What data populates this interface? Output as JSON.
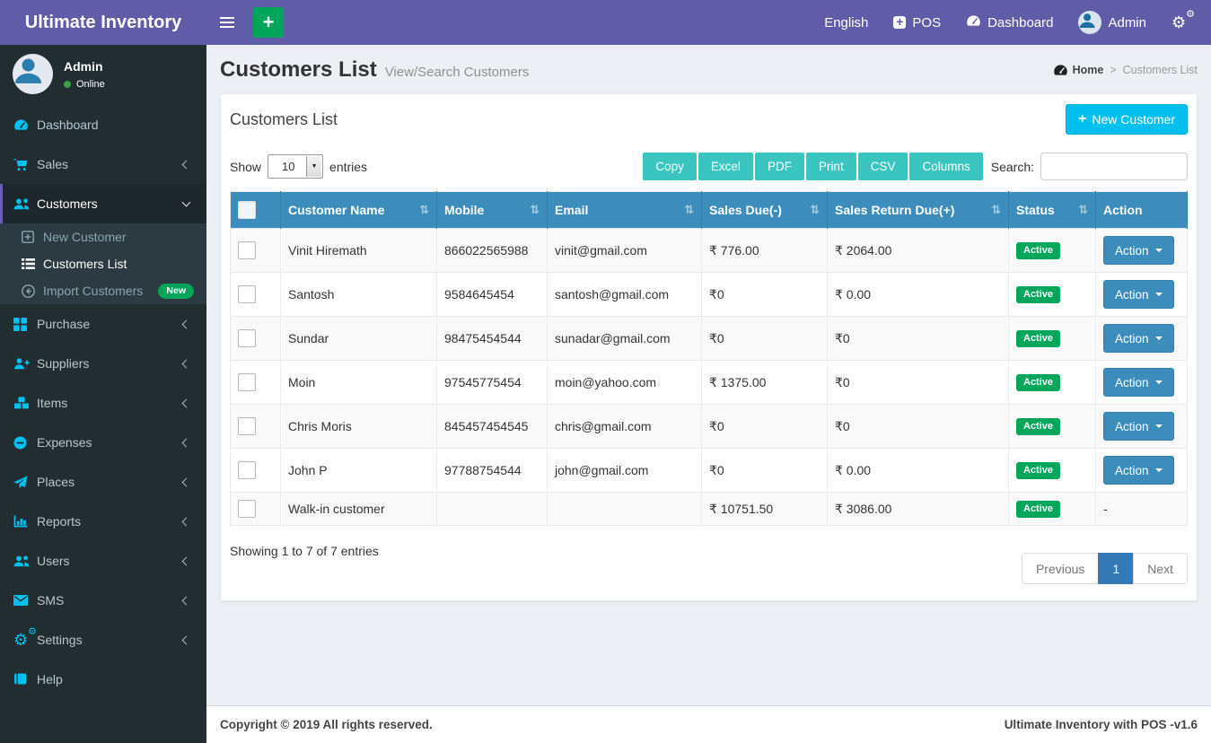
{
  "app": {
    "title": "Ultimate Inventory"
  },
  "topbar": {
    "language": "English",
    "pos_label": "POS",
    "dashboard_label": "Dashboard",
    "user": "Admin",
    "icons": [
      "menu-icon",
      "plus-button",
      "plus-square-icon",
      "gauge-icon",
      "avatar",
      "cogs-icon"
    ]
  },
  "sidebar": {
    "user": {
      "name": "Admin",
      "status": "Online"
    },
    "items": [
      {
        "label": "Dashboard",
        "icon": "gauge-icon",
        "chevron": null,
        "active": false
      },
      {
        "label": "Sales",
        "icon": "cart-icon",
        "chevron": "left",
        "active": false
      },
      {
        "label": "Customers",
        "icon": "users-icon",
        "chevron": "down",
        "active": true,
        "submenu": [
          {
            "label": "New Customer",
            "icon": "plus-square-icon",
            "active": false,
            "badge": null
          },
          {
            "label": "Customers List",
            "icon": "list-icon",
            "active": true,
            "badge": null
          },
          {
            "label": "Import Customers",
            "icon": "arrow-circle-left-icon",
            "active": false,
            "badge": "New"
          }
        ]
      },
      {
        "label": "Purchase",
        "icon": "grid-icon",
        "chevron": "left",
        "active": false
      },
      {
        "label": "Suppliers",
        "icon": "user-plus-icon",
        "chevron": "left",
        "active": false
      },
      {
        "label": "Items",
        "icon": "cubes-icon",
        "chevron": "left",
        "active": false
      },
      {
        "label": "Expenses",
        "icon": "minus-circle-icon",
        "chevron": "left",
        "active": false
      },
      {
        "label": "Places",
        "icon": "paper-plane-icon",
        "chevron": "left",
        "active": false
      },
      {
        "label": "Reports",
        "icon": "bar-chart-icon",
        "chevron": "left",
        "active": false
      },
      {
        "label": "Users",
        "icon": "users-icon",
        "chevron": "left",
        "active": false
      },
      {
        "label": "SMS",
        "icon": "envelope-icon",
        "chevron": "left",
        "active": false
      },
      {
        "label": "Settings",
        "icon": "cogs-icon",
        "chevron": "left",
        "active": false
      },
      {
        "label": "Help",
        "icon": "book-icon",
        "chevron": null,
        "active": false
      }
    ]
  },
  "page": {
    "title": "Customers List",
    "subtitle": "View/Search Customers",
    "breadcrumb": {
      "home": "Home",
      "separator": ">",
      "current": "Customers List"
    }
  },
  "card": {
    "title": "Customers List",
    "new_button_label": "New Customer"
  },
  "toolbar": {
    "show_label": "Show",
    "page_size": "10",
    "entries_label": "entries",
    "export_buttons": [
      "Copy",
      "Excel",
      "PDF",
      "Print",
      "CSV",
      "Columns"
    ],
    "search_label": "Search:",
    "search_value": ""
  },
  "table": {
    "columns": [
      {
        "label": "Customer Name",
        "sortable": true
      },
      {
        "label": "Mobile",
        "sortable": true
      },
      {
        "label": "Email",
        "sortable": true
      },
      {
        "label": "Sales Due(-)",
        "sortable": true
      },
      {
        "label": "Sales Return Due(+)",
        "sortable": true
      },
      {
        "label": "Status",
        "sortable": true
      },
      {
        "label": "Action",
        "sortable": false
      }
    ],
    "rows": [
      {
        "name": "Vinit Hiremath",
        "mobile": "866022565988",
        "email": "vinit@gmail.com",
        "sales_due": "₹ 776.00",
        "sales_return_due": "₹ 2064.00",
        "status": "Active",
        "action": "Action"
      },
      {
        "name": "Santosh",
        "mobile": "9584645454",
        "email": "santosh@gmail.com",
        "sales_due": "₹0",
        "sales_return_due": "₹ 0.00",
        "status": "Active",
        "action": "Action"
      },
      {
        "name": "Sundar",
        "mobile": "98475454544",
        "email": "sunadar@gmail.com",
        "sales_due": "₹0",
        "sales_return_due": "₹0",
        "status": "Active",
        "action": "Action"
      },
      {
        "name": "Moin",
        "mobile": "97545775454",
        "email": "moin@yahoo.com",
        "sales_due": "₹ 1375.00",
        "sales_return_due": "₹0",
        "status": "Active",
        "action": "Action"
      },
      {
        "name": "Chris Moris",
        "mobile": "845457454545",
        "email": "chris@gmail.com",
        "sales_due": "₹0",
        "sales_return_due": "₹0",
        "status": "Active",
        "action": "Action"
      },
      {
        "name": "John P",
        "mobile": "97788754544",
        "email": "john@gmail.com",
        "sales_due": "₹0",
        "sales_return_due": "₹ 0.00",
        "status": "Active",
        "action": "Action"
      },
      {
        "name": "Walk-in customer",
        "mobile": "",
        "email": "",
        "sales_due": "₹ 10751.50",
        "sales_return_due": "₹ 3086.00",
        "status": "Active",
        "action": "-"
      }
    ]
  },
  "table_footer": {
    "info": "Showing 1 to 7 of 7 entries",
    "pagination": {
      "previous": "Previous",
      "page": "1",
      "next": "Next"
    }
  },
  "footer": {
    "copyright": "Copyright © 2019 All rights reserved.",
    "version": "Ultimate Inventory with POS -v1.6"
  },
  "colors": {
    "header_purple": "#615ca8",
    "sidebar_dark": "#222d32",
    "submenu_dark": "#2c3b41",
    "table_header_blue": "#3c8dbc",
    "export_teal": "#3ac5c0",
    "success_green": "#00a65a",
    "info_cyan": "#00c0ef",
    "pagination_active_blue": "#337ab7",
    "content_bg": "#ecf0f5"
  }
}
